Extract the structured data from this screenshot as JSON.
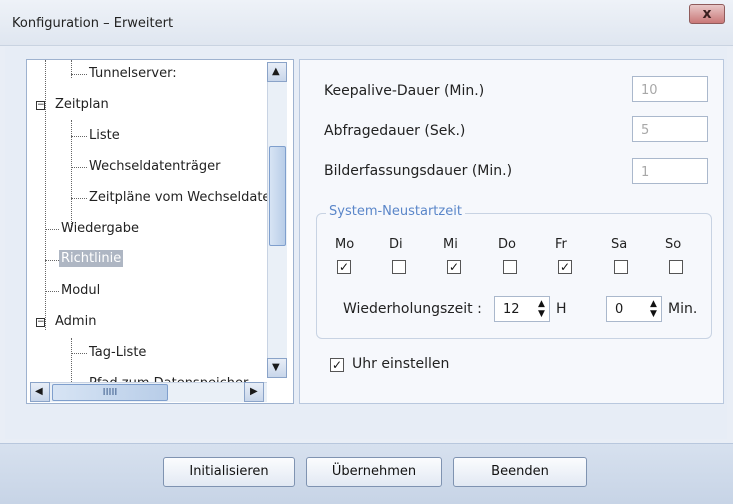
{
  "window": {
    "title": "Konfiguration – Erweitert",
    "close_glyph": "x"
  },
  "tree": {
    "items": [
      {
        "label": "Tunnelserver:"
      },
      {
        "label": "Zeitplan"
      },
      {
        "label": "Liste"
      },
      {
        "label": "Wechseldatenträger"
      },
      {
        "label": "Zeitpläne vom Wechseldate"
      },
      {
        "label": "Wiedergabe"
      },
      {
        "label": "Richtlinie"
      },
      {
        "label": "Modul"
      },
      {
        "label": "Admin"
      },
      {
        "label": "Tag-Liste"
      },
      {
        "label": "Pfad zum Datenspeicher"
      }
    ],
    "selected": "Richtlinie",
    "expander_minus": "−",
    "scroll_up": "▲",
    "scroll_down": "▼",
    "scroll_left": "◀",
    "scroll_right": "▶",
    "thumb_grip": "IIIII"
  },
  "settings": {
    "keepalive_label": "Keepalive-Dauer (Min.)",
    "keepalive_value": "10",
    "query_label": "Abfragedauer (Sek.)",
    "query_value": "5",
    "capture_label": "Bilderfassungsdauer (Min.)",
    "capture_value": "1"
  },
  "restart": {
    "title": "System-Neustartzeit",
    "days": [
      "Mo",
      "Di",
      "Mi",
      "Do",
      "Fr",
      "Sa",
      "So"
    ],
    "checked": [
      true,
      false,
      true,
      false,
      true,
      false,
      false
    ],
    "repeat_label": "Wiederholungszeit :",
    "hours_value": "12",
    "hours_unit": "H",
    "minutes_value": "0",
    "minutes_unit": "Min.",
    "check_glyph": "✓",
    "spin_arrows": "▲▼"
  },
  "clock": {
    "label": "Uhr einstellen",
    "checked": true
  },
  "buttons": {
    "init": "Initialisieren",
    "apply": "Übernehmen",
    "close": "Beenden"
  }
}
